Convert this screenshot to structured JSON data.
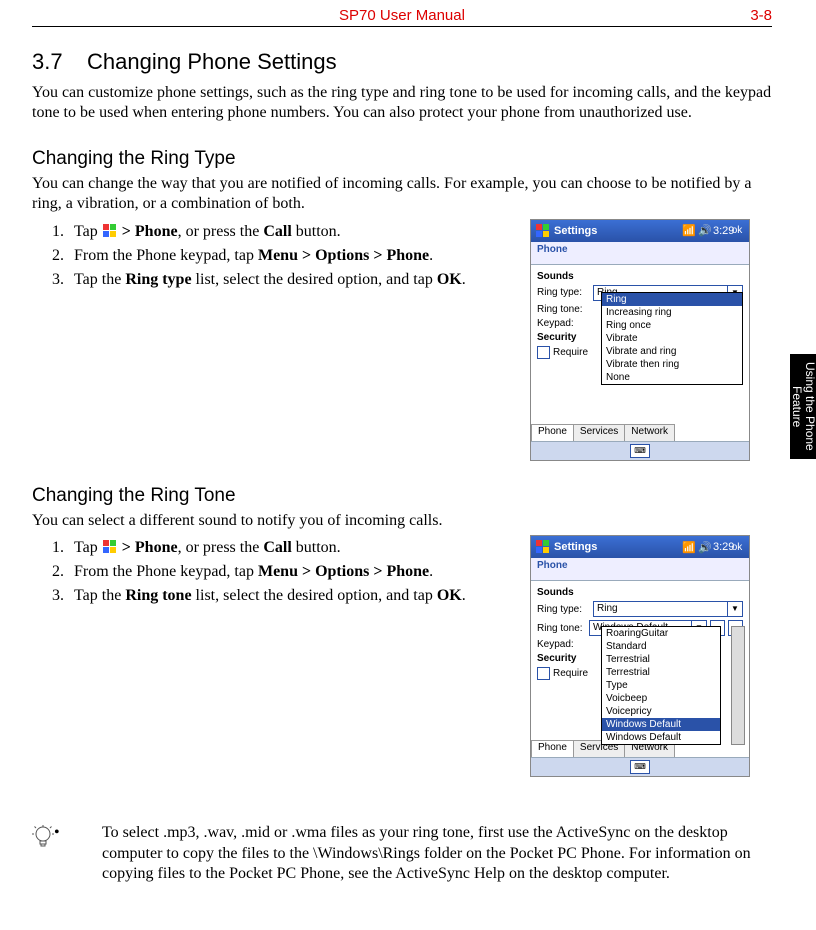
{
  "header": {
    "center": "SP70 User Manual",
    "right": "3-8"
  },
  "side_tab": "Using the Phone Feature",
  "sec": {
    "num": "3.7",
    "title": "Changing Phone Settings"
  },
  "intro": "You can customize phone settings, such as the ring type and ring tone to be used for incoming calls, and the keypad tone to be used when entering phone numbers. You can also protect your phone from unauthorized use.",
  "ringtype": {
    "title": "Changing the Ring Type",
    "intro": "You can change the way that you are notified of incoming calls. For example, you can choose to be notified by a ring, a vibration, or a combination of both.",
    "step1_a": "Tap ",
    "step1_b": " > ",
    "step1_phone": "Phone",
    "step1_c": ", or press the ",
    "step1_call": "Call",
    "step1_d": " button.",
    "step2_a": "From the Phone keypad, tap ",
    "step2_b": "Menu > Options > Phone",
    "step2_c": ".",
    "step3_a": "Tap the ",
    "step3_b": "Ring type",
    "step3_c": " list, select the desired option, and tap ",
    "step3_ok": "OK",
    "step3_d": "."
  },
  "ringtone": {
    "title": "Changing the Ring Tone",
    "intro": "You can select a different sound to notify you of incoming calls.",
    "step1_a": "Tap ",
    "step1_b": " > ",
    "step1_phone": "Phone",
    "step1_c": ", or press the ",
    "step1_call": "Call",
    "step1_d": " button.",
    "step2_a": "From the Phone keypad, tap ",
    "step2_b": "Menu > Options > Phone",
    "step2_c": ".",
    "step3_a": "Tap the ",
    "step3_b": "Ring tone",
    "step3_c": " list, select the desired option, and tap ",
    "step3_ok": "OK",
    "step3_d": "."
  },
  "tip": "To select .mp3, .wav, .mid or .wma files as your ring tone, first use the ActiveSync on the desktop computer to copy the files to the \\Windows\\Rings folder on the Pocket PC Phone. For information on copying files to the Pocket PC Phone, see the ActiveSync Help on the desktop computer.",
  "shot_common": {
    "title": "Settings",
    "time": "3:29",
    "ok": "ok",
    "section": "Phone",
    "sounds": "Sounds",
    "lab_type": "Ring type:",
    "lab_tone": "Ring tone:",
    "lab_keypad": "Keypad:",
    "security": "Security",
    "require": "Require",
    "tabs": [
      "Phone",
      "Services",
      "Network"
    ]
  },
  "shot1": {
    "type_value": "Ring",
    "drop": [
      "Ring",
      "Increasing ring",
      "Ring once",
      "Vibrate",
      "Vibrate and ring",
      "Vibrate then ring",
      "None"
    ],
    "sel_index": 0
  },
  "shot2": {
    "type_value": "Ring",
    "tone_value": "Windows Default",
    "drop": [
      "RoaringGuitar",
      "Standard",
      "Terrestrial",
      "Terrestrial",
      "Type",
      "Voicbeep",
      "Voicepricy",
      "Windows Default",
      "Windows Default"
    ],
    "sel_index": 7
  }
}
